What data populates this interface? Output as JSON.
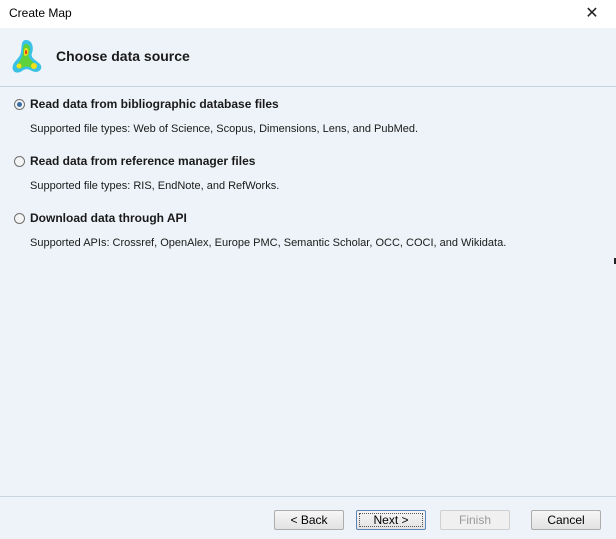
{
  "window": {
    "title": "Create Map",
    "close_glyph": "✕"
  },
  "header": {
    "title": "Choose data source",
    "logo_icon": "vosviewer-density-map-icon"
  },
  "options": [
    {
      "label": "Read data from bibliographic database files",
      "description": "Supported file types: Web of Science, Scopus, Dimensions, Lens, and PubMed.",
      "selected": true
    },
    {
      "label": "Read data from reference manager files",
      "description": "Supported file types: RIS, EndNote, and RefWorks.",
      "selected": false
    },
    {
      "label": "Download data through API",
      "description": "Supported APIs: Crossref, OpenAlex, Europe PMC, Semantic Scholar, OCC, COCI, and Wikidata.",
      "selected": false
    }
  ],
  "buttons": {
    "back": "< Back",
    "next": "Next >",
    "finish": "Finish",
    "cancel": "Cancel"
  },
  "colors": {
    "panel_background": "#edf3f8",
    "radio_selected": "#3b6ea5"
  }
}
